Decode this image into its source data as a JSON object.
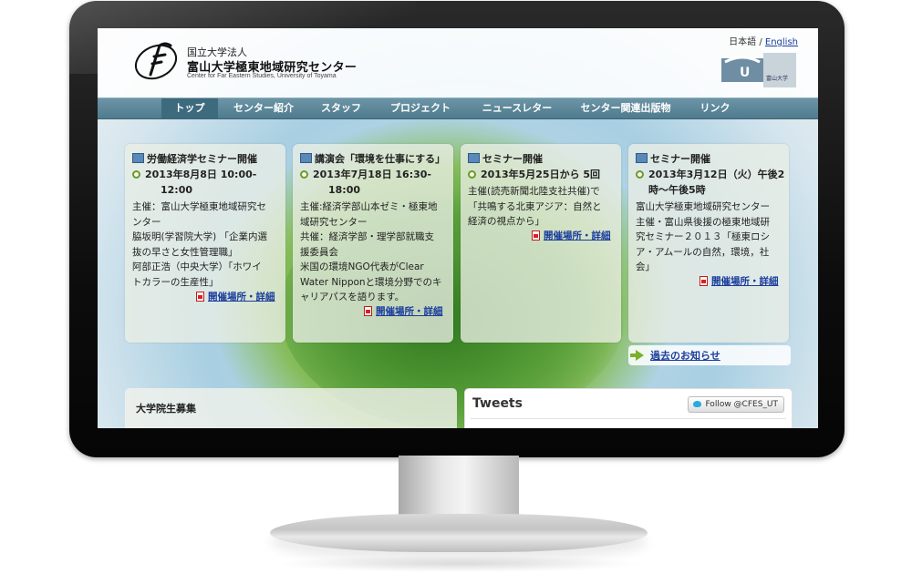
{
  "header": {
    "logo_line1": "国立大学法人",
    "logo_line2": "富山大学極東地域研究センター",
    "logo_line3": "Center for Far Eastern Studies, University of Toyama",
    "lang_jp": "日本語",
    "lang_sep": " / ",
    "lang_en": "English",
    "uni_logo_text": "富山大学"
  },
  "nav": {
    "items": [
      "トップ",
      "センター紹介",
      "スタッフ",
      "プロジェクト",
      "ニュースレター",
      "センター関連出版物",
      "リンク"
    ],
    "active_index": 0
  },
  "cards": [
    {
      "title": "労働経済学セミナー開催",
      "date_line1": "2013年8月8日 10:00-",
      "date_line2": "12:00",
      "body": [
        "主催：富山大学極東地域研究セ",
        "ンター",
        "脇坂明(学習院大学) 「企業内選",
        "抜の早さと女性管理職」",
        "阿部正浩（中央大学）「ホワイ",
        "トカラーの生産性」"
      ],
      "link": "開催場所・詳細"
    },
    {
      "title": "講演会「環境を仕事にする」",
      "date_line1": "2013年7月18日 16:30-",
      "date_line2": "18:00",
      "body": [
        "主催:経済学部山本ゼミ・極東地",
        "域研究センター",
        "共催：経済学部・理学部就職支",
        "援委員会",
        "米国の環境NGO代表がClear",
        "Water Nipponと環境分野でのキ",
        "ャリアパスを語ります。"
      ],
      "link": "開催場所・詳細"
    },
    {
      "title": "セミナー開催",
      "date_line1": "2013年5月25日から 5回",
      "date_line2": "",
      "body": [
        "主催(読売新聞北陸支社共催)で",
        "「共鳴する北東アジア：自然と",
        "経済の視点から」"
      ],
      "link": "開催場所・詳細"
    },
    {
      "title": "セミナー開催",
      "date_line1": "2013年3月12日（火）午後2",
      "date_line2": "時～午後5時",
      "body": [
        "富山大学極東地域研究センター",
        "主催・富山県後援の極東ロシア",
        "ア・アムールの自然，環境，社",
        "会」"
      ],
      "body_alt": [
        "富山大学極東地域研究センター",
        "主催・富山県後援の極東地域研",
        "究セミナー２０１３「極東ロシ",
        "ア・アムールの自然，環境，社",
        "会」"
      ],
      "link": "開催場所・詳細"
    }
  ],
  "past_news": "過去のお知らせ",
  "bottom_left_title": "大学院生募集",
  "tweets": {
    "title": "Tweets",
    "follow_label": "Follow @CFES_UT"
  },
  "colors": {
    "nav_bg": "#5a8597",
    "nav_active": "#3e6a7d",
    "link": "#1a3c9c"
  }
}
